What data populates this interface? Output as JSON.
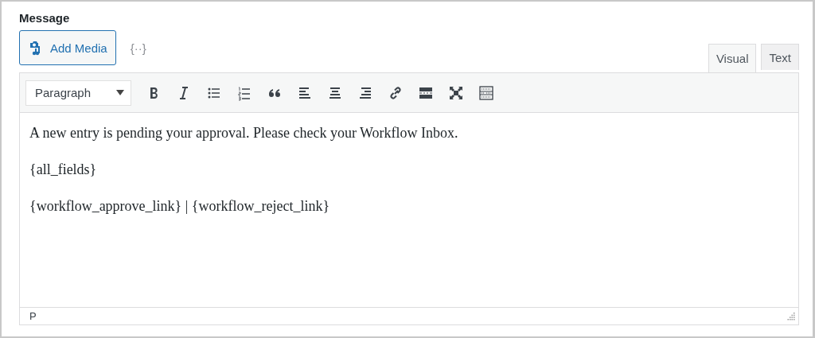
{
  "field_label": "Message",
  "add_media": {
    "label": "Add Media"
  },
  "merge_tags_button": {
    "label": "{··}"
  },
  "tabs": [
    {
      "label": "Visual",
      "selected": true
    },
    {
      "label": "Text",
      "selected": false
    }
  ],
  "format_select": {
    "value": "Paragraph"
  },
  "toolbar": [
    {
      "kind": "bold"
    },
    {
      "kind": "italic"
    },
    {
      "kind": "bullets"
    },
    {
      "kind": "numbers"
    },
    {
      "kind": "quote"
    },
    {
      "kind": "left"
    },
    {
      "kind": "center"
    },
    {
      "kind": "right"
    },
    {
      "kind": "link"
    },
    {
      "kind": "more"
    },
    {
      "kind": "fullscreen"
    },
    {
      "kind": "kitchen"
    }
  ],
  "content": [
    "A new entry is pending your approval. Please check your Workflow Inbox.",
    "{all_fields}",
    "{workflow_approve_link} | {workflow_reject_link}"
  ],
  "status_path": "P"
}
